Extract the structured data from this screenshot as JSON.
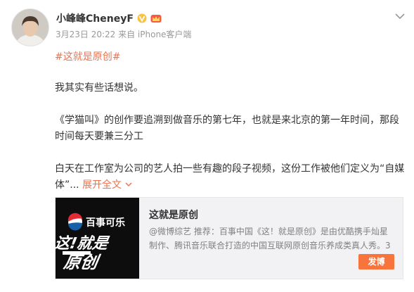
{
  "user": {
    "name": "小峰峰CheneyF",
    "meta": "3月23日 20:22 来自 iPhone客户端"
  },
  "post": {
    "hashtag": "#这就是原创#",
    "lines": [
      "我其实有些话想说。",
      "《学猫叫》的创作要追溯到做音乐的第七年，也就是来北京的第一年时间，那段",
      "时间每天要兼三分工",
      "白天在工作室为公司的艺人拍一些有趣的段子视频，这份工作被他们定义为“自媒"
    ],
    "last_line_prefix": "体”...",
    "expand_label": "展开全文"
  },
  "card": {
    "title": "这就是原创",
    "desc_line1": "@微博综艺 推荐：百事中国《这！就是原创》是由优酷携手灿星",
    "desc_line2": "制作、腾讯音乐联合打造的中国互联网原创音乐养成类真人秀。3",
    "button": "发博",
    "thumb_brand": "百事可乐",
    "thumb_title": "这!就是原创"
  },
  "colors": {
    "accent": "#eb7350",
    "button": "#f7753d",
    "verified": "#f6c343"
  },
  "icons": [
    "avatar",
    "verified-icon",
    "vip-crown-icon",
    "chevron-down-icon",
    "expand-chevron-icon"
  ]
}
